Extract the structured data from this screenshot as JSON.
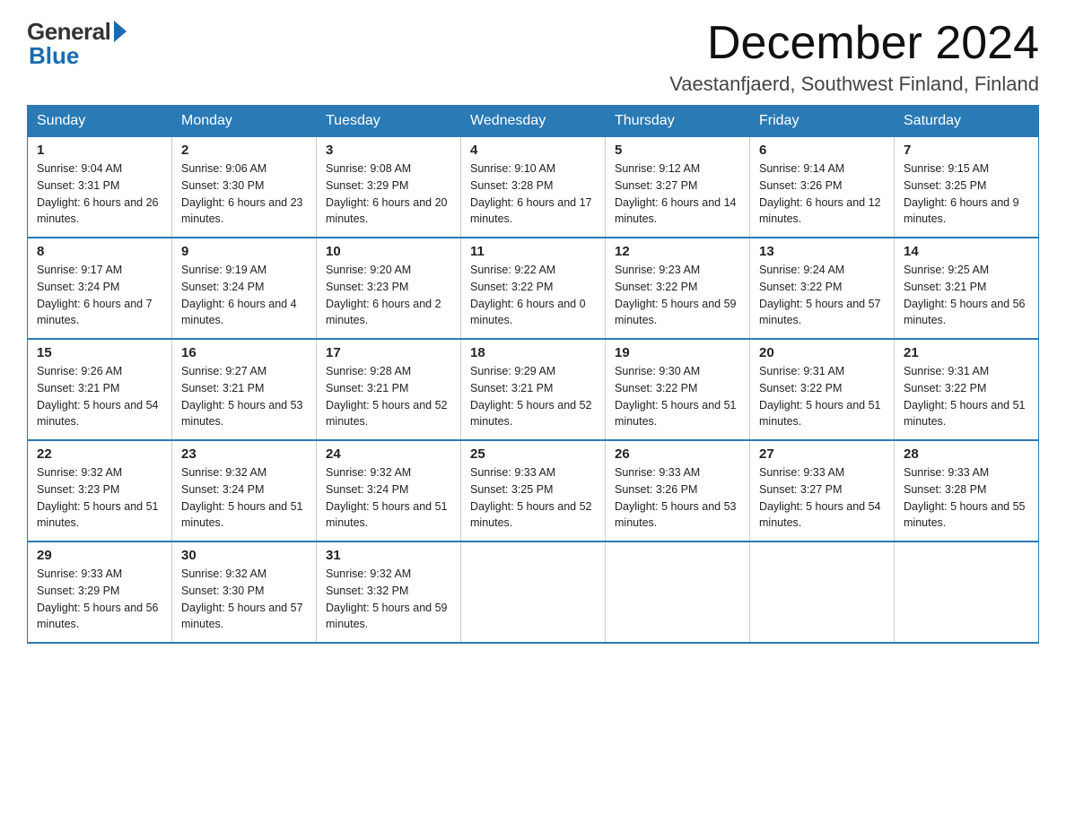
{
  "header": {
    "logo_general": "General",
    "logo_blue": "Blue",
    "month_title": "December 2024",
    "location": "Vaestanfjaerd, Southwest Finland, Finland"
  },
  "days_of_week": [
    "Sunday",
    "Monday",
    "Tuesday",
    "Wednesday",
    "Thursday",
    "Friday",
    "Saturday"
  ],
  "weeks": [
    [
      {
        "day": "1",
        "sunrise": "9:04 AM",
        "sunset": "3:31 PM",
        "daylight": "6 hours and 26 minutes."
      },
      {
        "day": "2",
        "sunrise": "9:06 AM",
        "sunset": "3:30 PM",
        "daylight": "6 hours and 23 minutes."
      },
      {
        "day": "3",
        "sunrise": "9:08 AM",
        "sunset": "3:29 PM",
        "daylight": "6 hours and 20 minutes."
      },
      {
        "day": "4",
        "sunrise": "9:10 AM",
        "sunset": "3:28 PM",
        "daylight": "6 hours and 17 minutes."
      },
      {
        "day": "5",
        "sunrise": "9:12 AM",
        "sunset": "3:27 PM",
        "daylight": "6 hours and 14 minutes."
      },
      {
        "day": "6",
        "sunrise": "9:14 AM",
        "sunset": "3:26 PM",
        "daylight": "6 hours and 12 minutes."
      },
      {
        "day": "7",
        "sunrise": "9:15 AM",
        "sunset": "3:25 PM",
        "daylight": "6 hours and 9 minutes."
      }
    ],
    [
      {
        "day": "8",
        "sunrise": "9:17 AM",
        "sunset": "3:24 PM",
        "daylight": "6 hours and 7 minutes."
      },
      {
        "day": "9",
        "sunrise": "9:19 AM",
        "sunset": "3:24 PM",
        "daylight": "6 hours and 4 minutes."
      },
      {
        "day": "10",
        "sunrise": "9:20 AM",
        "sunset": "3:23 PM",
        "daylight": "6 hours and 2 minutes."
      },
      {
        "day": "11",
        "sunrise": "9:22 AM",
        "sunset": "3:22 PM",
        "daylight": "6 hours and 0 minutes."
      },
      {
        "day": "12",
        "sunrise": "9:23 AM",
        "sunset": "3:22 PM",
        "daylight": "5 hours and 59 minutes."
      },
      {
        "day": "13",
        "sunrise": "9:24 AM",
        "sunset": "3:22 PM",
        "daylight": "5 hours and 57 minutes."
      },
      {
        "day": "14",
        "sunrise": "9:25 AM",
        "sunset": "3:21 PM",
        "daylight": "5 hours and 56 minutes."
      }
    ],
    [
      {
        "day": "15",
        "sunrise": "9:26 AM",
        "sunset": "3:21 PM",
        "daylight": "5 hours and 54 minutes."
      },
      {
        "day": "16",
        "sunrise": "9:27 AM",
        "sunset": "3:21 PM",
        "daylight": "5 hours and 53 minutes."
      },
      {
        "day": "17",
        "sunrise": "9:28 AM",
        "sunset": "3:21 PM",
        "daylight": "5 hours and 52 minutes."
      },
      {
        "day": "18",
        "sunrise": "9:29 AM",
        "sunset": "3:21 PM",
        "daylight": "5 hours and 52 minutes."
      },
      {
        "day": "19",
        "sunrise": "9:30 AM",
        "sunset": "3:22 PM",
        "daylight": "5 hours and 51 minutes."
      },
      {
        "day": "20",
        "sunrise": "9:31 AM",
        "sunset": "3:22 PM",
        "daylight": "5 hours and 51 minutes."
      },
      {
        "day": "21",
        "sunrise": "9:31 AM",
        "sunset": "3:22 PM",
        "daylight": "5 hours and 51 minutes."
      }
    ],
    [
      {
        "day": "22",
        "sunrise": "9:32 AM",
        "sunset": "3:23 PM",
        "daylight": "5 hours and 51 minutes."
      },
      {
        "day": "23",
        "sunrise": "9:32 AM",
        "sunset": "3:24 PM",
        "daylight": "5 hours and 51 minutes."
      },
      {
        "day": "24",
        "sunrise": "9:32 AM",
        "sunset": "3:24 PM",
        "daylight": "5 hours and 51 minutes."
      },
      {
        "day": "25",
        "sunrise": "9:33 AM",
        "sunset": "3:25 PM",
        "daylight": "5 hours and 52 minutes."
      },
      {
        "day": "26",
        "sunrise": "9:33 AM",
        "sunset": "3:26 PM",
        "daylight": "5 hours and 53 minutes."
      },
      {
        "day": "27",
        "sunrise": "9:33 AM",
        "sunset": "3:27 PM",
        "daylight": "5 hours and 54 minutes."
      },
      {
        "day": "28",
        "sunrise": "9:33 AM",
        "sunset": "3:28 PM",
        "daylight": "5 hours and 55 minutes."
      }
    ],
    [
      {
        "day": "29",
        "sunrise": "9:33 AM",
        "sunset": "3:29 PM",
        "daylight": "5 hours and 56 minutes."
      },
      {
        "day": "30",
        "sunrise": "9:32 AM",
        "sunset": "3:30 PM",
        "daylight": "5 hours and 57 minutes."
      },
      {
        "day": "31",
        "sunrise": "9:32 AM",
        "sunset": "3:32 PM",
        "daylight": "5 hours and 59 minutes."
      },
      null,
      null,
      null,
      null
    ]
  ],
  "labels": {
    "sunrise": "Sunrise: ",
    "sunset": "Sunset: ",
    "daylight": "Daylight: "
  }
}
